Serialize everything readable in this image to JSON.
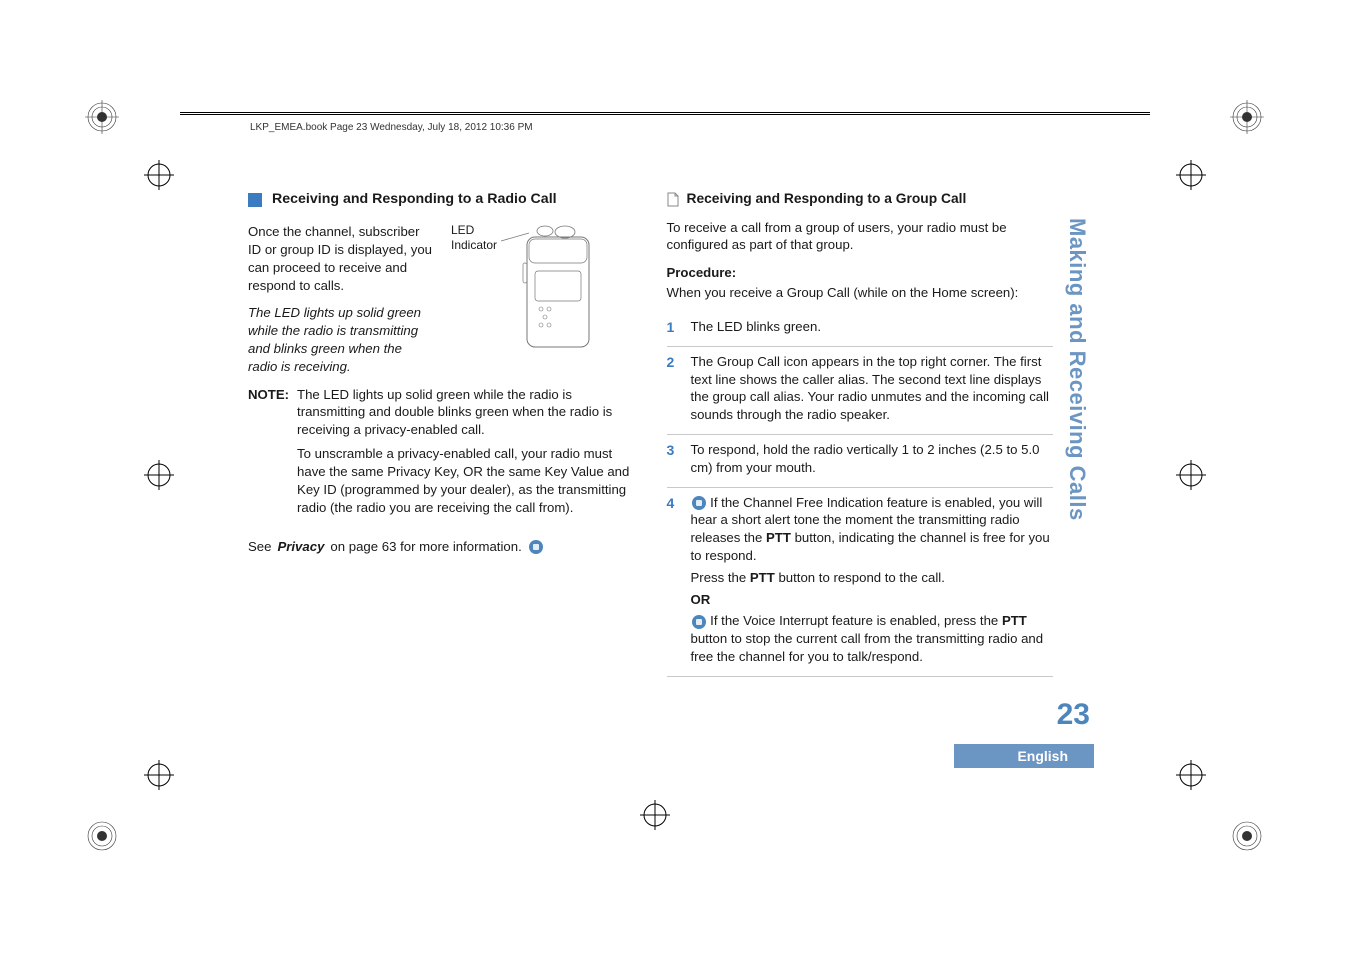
{
  "header": "LKP_EMEA.book  Page 23  Wednesday, July 18, 2012  10:36 PM",
  "left": {
    "section_title": "Receiving and Responding to a Radio Call",
    "intro_p1": "Once the channel, subscriber ID or group ID is displayed, you can proceed to receive and respond to calls.",
    "fig_label_1": "LED",
    "fig_label_2": "Indicator",
    "intro_p2": "The LED lights up solid green while the radio is transmitting and blinks green when the radio is receiving.",
    "note_label": "NOTE:",
    "note_p1": "The LED lights up solid green while the radio is transmitting and double blinks green when the radio is receiving a privacy-enabled call.",
    "note_p2": "To unscramble a privacy-enabled call, your radio must have the same Privacy Key, OR the same Key Value and Key ID (programmed by your dealer), as the transmitting radio (the radio you are receiving the call from).",
    "see_prefix": "See ",
    "see_link": "Privacy",
    "see_suffix": " on page 63 for more information."
  },
  "right": {
    "sub_title": "Receiving and Responding to a Group Call",
    "intro": "To receive a call from a group of users, your radio must be configured as part of that group.",
    "proc_label": "Procedure:",
    "proc_intro": "When you receive a Group Call (while on the Home screen):",
    "step1": "The LED blinks green.",
    "step2": "The Group Call icon appears in the top right corner. The first text line shows the caller alias. The second text line displays the group call alias. Your radio unmutes and the incoming call sounds through the radio speaker.",
    "step3": "To respond, hold the radio vertically 1 to 2 inches (2.5 to 5.0 cm) from your mouth.",
    "step4_a_pre": " If the Channel Free Indication feature is enabled, you will hear a short alert tone the moment the transmitting radio releases the ",
    "step4_a_btn": "PTT",
    "step4_a_post": " button, indicating the channel is free for you to respond.",
    "step4_press_pre": "Press the ",
    "step4_press_btn": "PTT",
    "step4_press_post": " button to respond to the call.",
    "step4_or": "OR",
    "step4_b_pre": " If the Voice Interrupt feature is enabled, press the ",
    "step4_b_btn": "PTT",
    "step4_b_post": " button to stop the current call from the transmitting radio and free the channel for you to talk/respond."
  },
  "side_tab": "Making and Receiving Calls",
  "page_number": "23",
  "language": "English"
}
